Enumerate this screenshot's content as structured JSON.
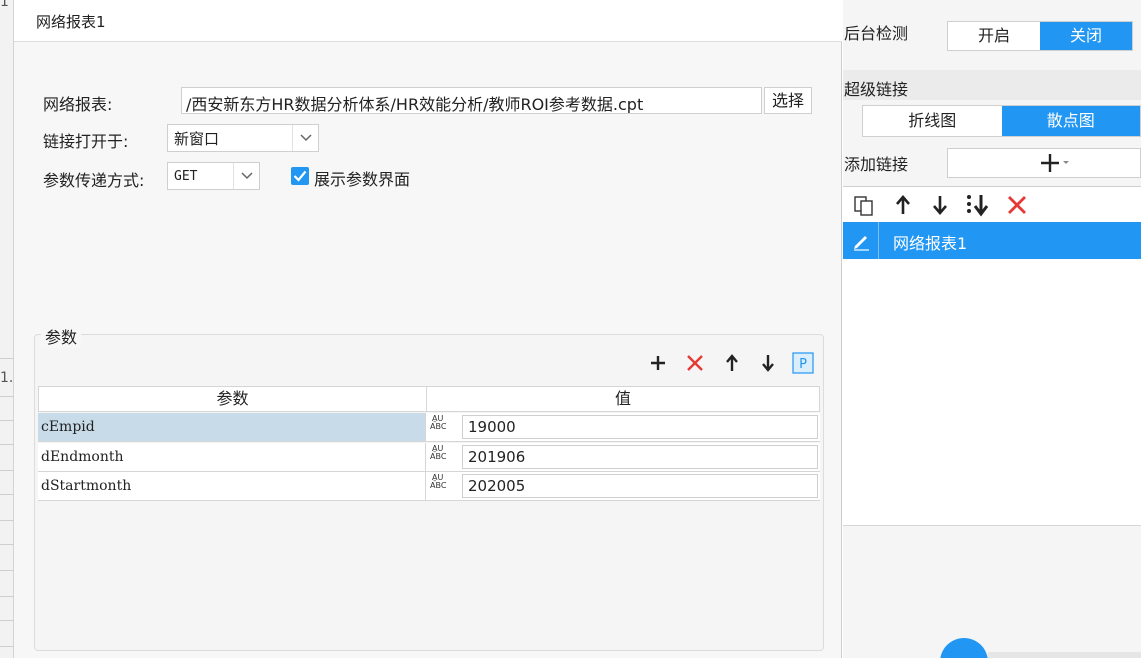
{
  "background": {
    "fragment_top": "1",
    "fragment_mid": "1."
  },
  "dialog": {
    "title": "网络报表1",
    "report_label": "网络报表:",
    "report_path": "/西安新东方HR数据分析体系/HR效能分析/教师ROI参考数据.cpt",
    "choose_button": "选择",
    "open_in_label": "链接打开于:",
    "open_in_value": "新窗口",
    "method_label": "参数传递方式:",
    "method_value": "GET",
    "show_params_label": "展示参数界面",
    "show_params_checked": true,
    "params_group_title": "参数",
    "params_table": {
      "headers": [
        "参数",
        "值"
      ],
      "rows": [
        {
          "name": "cEmpid",
          "value": "19000"
        },
        {
          "name": "dEndmonth",
          "value": "201906"
        },
        {
          "name": "dStartmonth",
          "value": "202005"
        }
      ]
    },
    "type_icon_top": "A̱U",
    "type_icon_bottom": "ABC"
  },
  "right_panel": {
    "bg_check_label": "后台检测",
    "bg_check_on": "开启",
    "bg_check_off": "关闭",
    "hyperlink_label": "超级链接",
    "tab_line": "折线图",
    "tab_scatter": "散点图",
    "add_link_label": "添加链接",
    "link_items": [
      "网络报表1"
    ]
  },
  "colors": {
    "accent": "#2196f3",
    "danger": "#e53935",
    "selected_row": "#c8dbe8"
  }
}
